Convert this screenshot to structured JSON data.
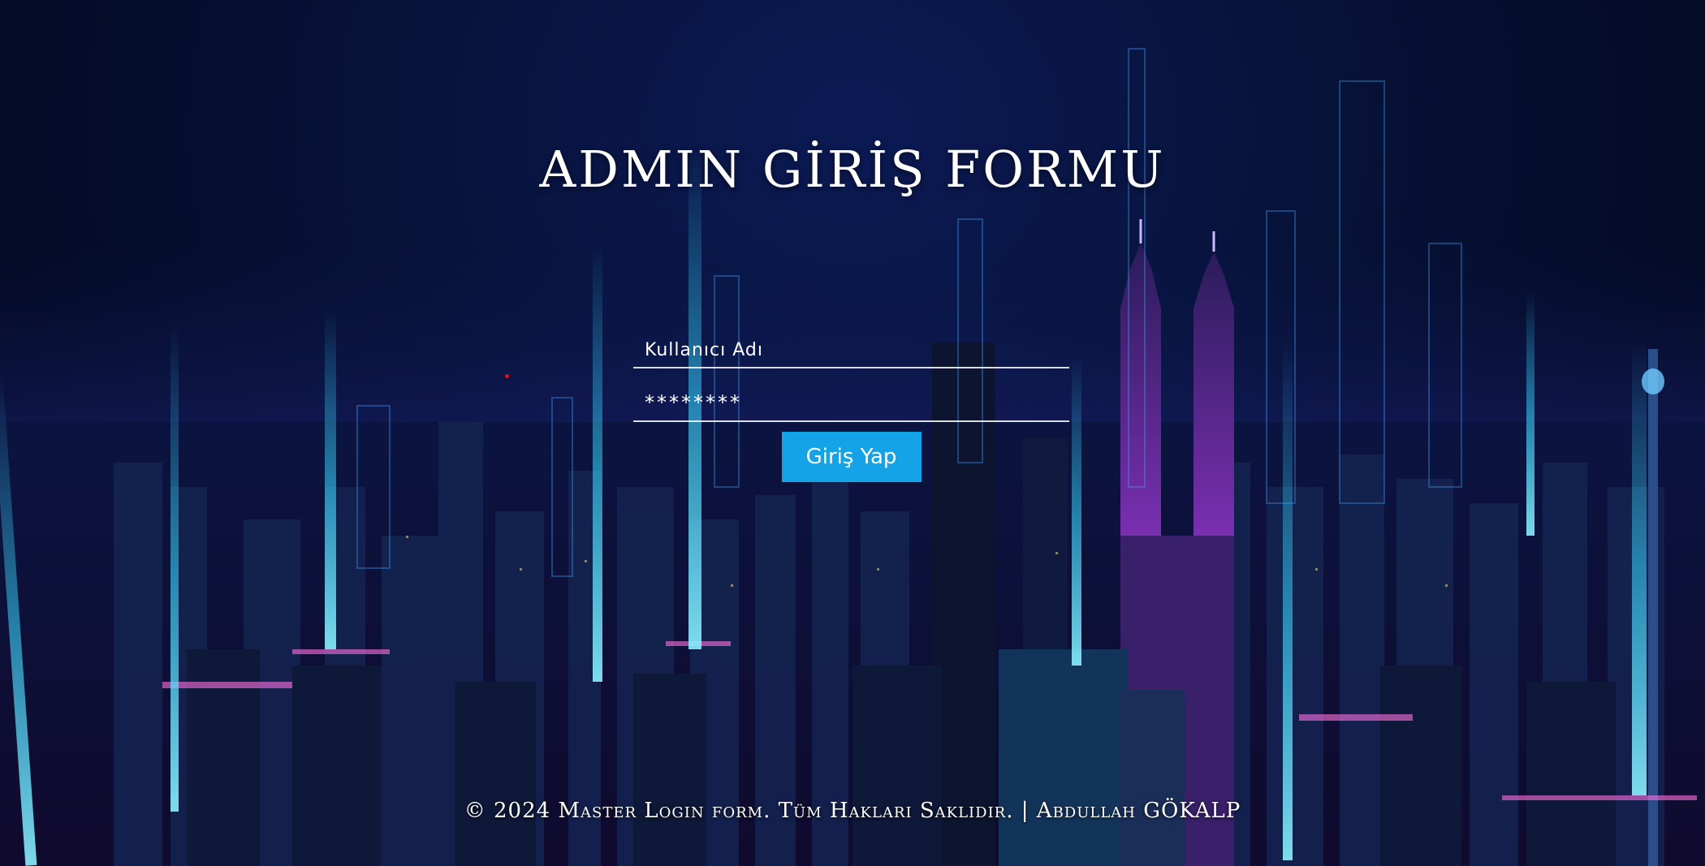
{
  "page": {
    "title": "ADMIN GİRİŞ FORMU",
    "footer": "© 2024 Master Login form. Tüm Hakları Saklıdır. | Abdullah GÖKALP"
  },
  "form": {
    "username_placeholder": "Kullanıcı Adı",
    "password_value": "********",
    "submit_label": "Giriş Yap"
  },
  "colors": {
    "accent": "#13a3e6",
    "background": "#071238",
    "text": "#ffffff"
  },
  "background_image": "night-city-skyline-with-light-beams"
}
